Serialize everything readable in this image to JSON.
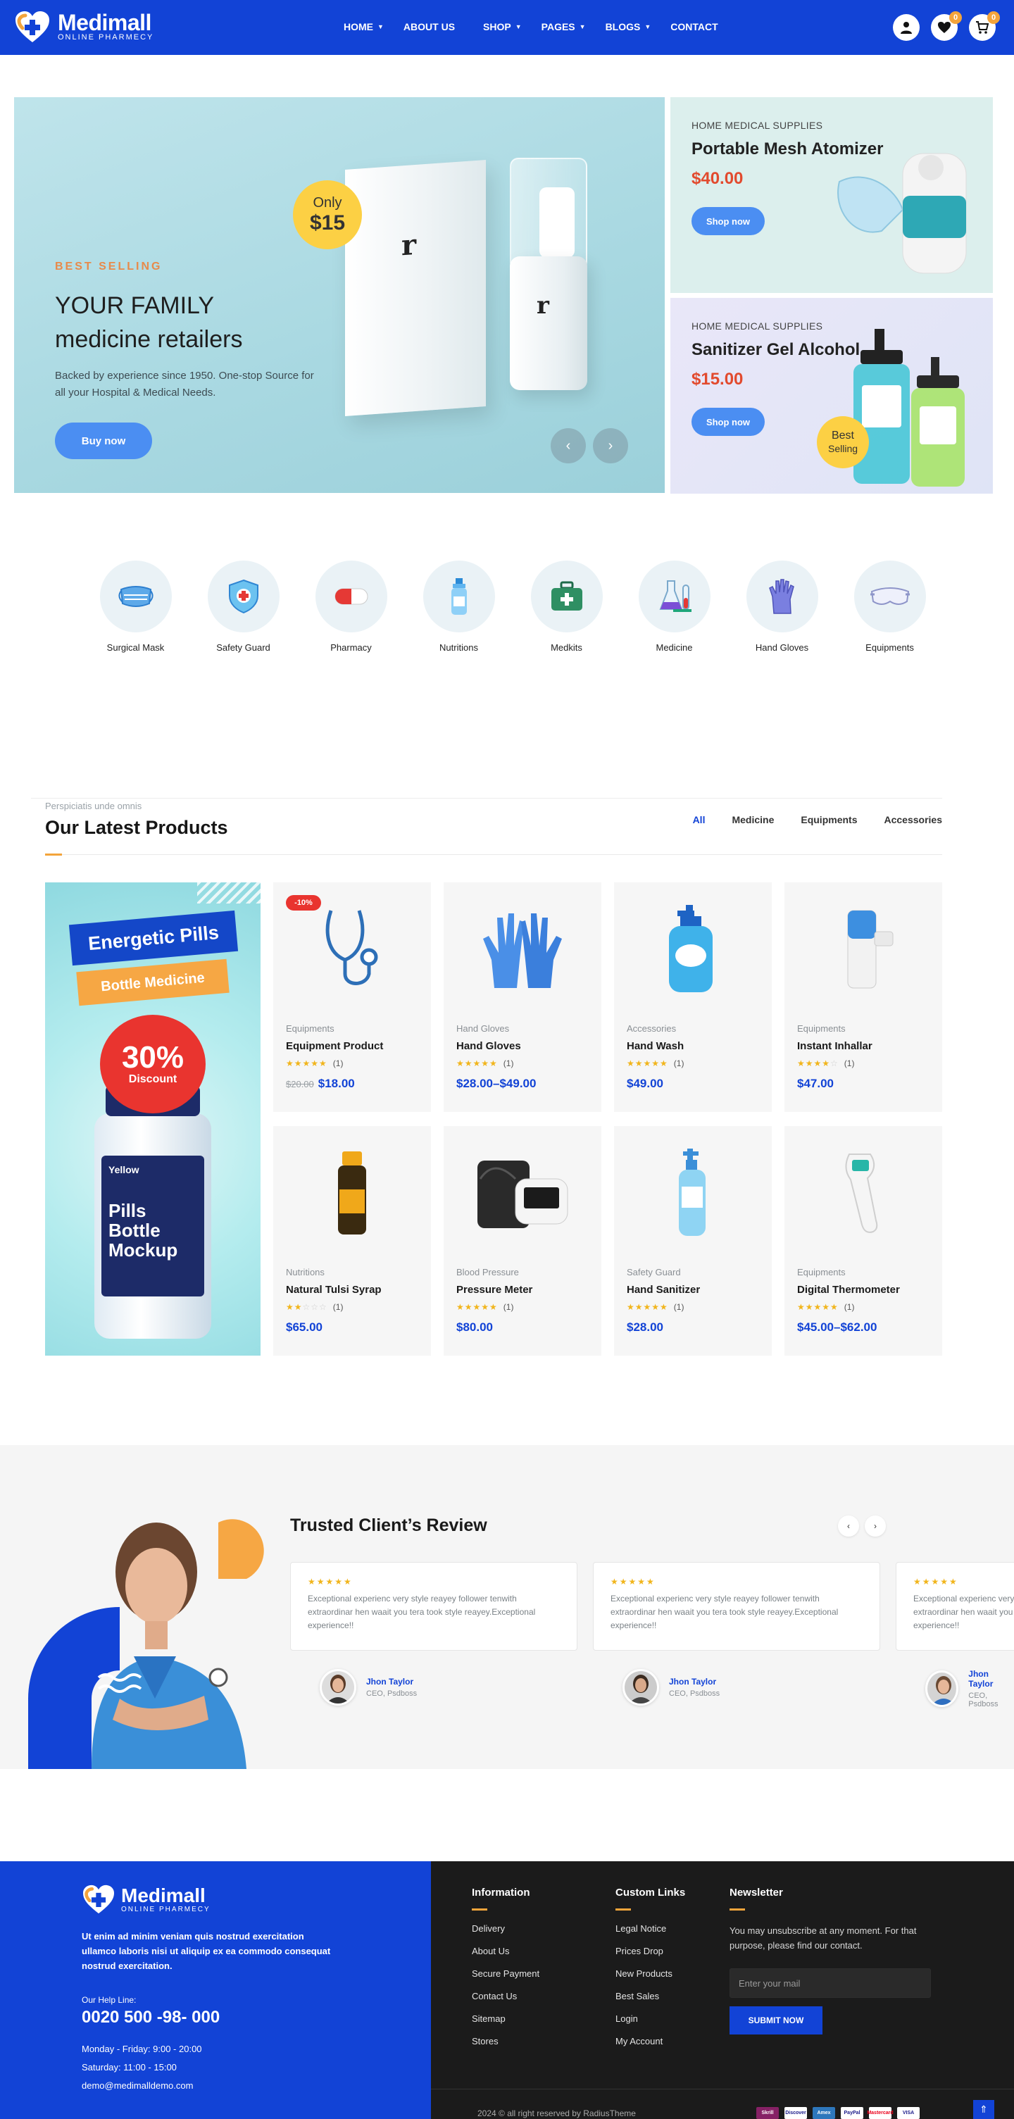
{
  "header": {
    "brand": "Medimall",
    "tagline": "ONLINE PHARMECY",
    "nav": [
      {
        "label": "HOME",
        "dropdown": true
      },
      {
        "label": "ABOUT US",
        "dropdown": false
      },
      {
        "label": "SHOP",
        "dropdown": true
      },
      {
        "label": "PAGES",
        "dropdown": true
      },
      {
        "label": "BLOGS",
        "dropdown": true
      },
      {
        "label": "CONTACT",
        "dropdown": false
      }
    ],
    "wishlist_count": "0",
    "cart_count": "0"
  },
  "hero": {
    "tag": "BEST SELLING",
    "title_line1": "YOUR FAMILY",
    "title_line2": "medicine retailers",
    "description": "Backed by experience since 1950. One-stop Source for all your Hospital & Medical Needs.",
    "button": "Buy now",
    "price_only": "Only",
    "price_amount": "$15",
    "box_brand": "r"
  },
  "promos": [
    {
      "category": "HOME MEDICAL SUPPLIES",
      "name": "Portable Mesh Atomizer",
      "price": "$40.00",
      "button": "Shop now"
    },
    {
      "category": "HOME MEDICAL SUPPLIES",
      "name": "Sanitizer Gel Alcohol",
      "price": "$15.00",
      "button": "Shop now",
      "badge_line1": "Best",
      "badge_line2": "Selling"
    }
  ],
  "categories": [
    {
      "label": "Surgical Mask",
      "icon": "surgical-mask-icon"
    },
    {
      "label": "Safety Guard",
      "icon": "safety-guard-icon"
    },
    {
      "label": "Pharmacy",
      "icon": "pharmacy-icon"
    },
    {
      "label": "Nutritions",
      "icon": "nutritions-icon"
    },
    {
      "label": "Medkits",
      "icon": "medkits-icon"
    },
    {
      "label": "Medicine",
      "icon": "medicine-icon"
    },
    {
      "label": "Hand Gloves",
      "icon": "hand-gloves-icon"
    },
    {
      "label": "Equipments",
      "icon": "equipments-icon"
    }
  ],
  "latest": {
    "subtitle": "Perspiciatis unde omnis",
    "title": "Our Latest Products",
    "tabs": [
      "All",
      "Medicine",
      "Equipments",
      "Accessories"
    ],
    "banner": {
      "title": "Energetic Pills",
      "subtitle": "Bottle Medicine",
      "discount": "30%",
      "discount_label": "Discount",
      "bottle_brand": "Yellow",
      "bottle_line1": "Pills",
      "bottle_line2": "Bottle",
      "bottle_line3": "Mockup"
    },
    "products": [
      {
        "category": "Equipments",
        "name": "Equipment Product",
        "rating": 5,
        "reviews": "(1)",
        "old_price": "$20.00",
        "price": "$18.00",
        "badge": "-10%"
      },
      {
        "category": "Hand Gloves",
        "name": "Hand Gloves",
        "rating": 5,
        "reviews": "(1)",
        "old_price": "",
        "price": "$28.00–$49.00",
        "badge": ""
      },
      {
        "category": "Accessories",
        "name": "Hand Wash",
        "rating": 5,
        "reviews": "(1)",
        "old_price": "",
        "price": "$49.00",
        "badge": ""
      },
      {
        "category": "Equipments",
        "name": "Instant Inhallar",
        "rating": 4,
        "reviews": "(1)",
        "old_price": "",
        "price": "$47.00",
        "badge": ""
      },
      {
        "category": "Nutritions",
        "name": "Natural Tulsi Syrap",
        "rating": 2,
        "reviews": "(1)",
        "old_price": "",
        "price": "$65.00",
        "badge": ""
      },
      {
        "category": "Blood Pressure",
        "name": "Pressure Meter",
        "rating": 5,
        "reviews": "(1)",
        "old_price": "",
        "price": "$80.00",
        "badge": ""
      },
      {
        "category": "Safety Guard",
        "name": "Hand Sanitizer",
        "rating": 5,
        "reviews": "(1)",
        "old_price": "",
        "price": "$28.00",
        "badge": ""
      },
      {
        "category": "Equipments",
        "name": "Digital Thermometer",
        "rating": 5,
        "reviews": "(1)",
        "old_price": "",
        "price": "$45.00–$62.00",
        "badge": ""
      }
    ]
  },
  "reviews": {
    "title": "Trusted Client’s Review",
    "items": [
      {
        "text": "Exceptional experienc very style reayey follower tenwith extraordinar hen waait you tera took style reayey.Exceptional experience!!",
        "name": "Jhon Taylor",
        "role": "CEO, Psdboss"
      },
      {
        "text": "Exceptional experienc very style reayey follower tenwith extraordinar hen waait you tera took style reayey.Exceptional experience!!",
        "name": "Jhon Taylor",
        "role": "CEO, Psdboss"
      },
      {
        "text": "Exceptional experienc very style reayey follower tenwith extraordinar hen waait you tera took style reayey.Exceptional experience!!",
        "name": "Jhon Taylor",
        "role": "CEO, Psdboss"
      }
    ]
  },
  "footer": {
    "brand": "Medimall",
    "tagline": "ONLINE PHARMECY",
    "about": "Ut enim ad minim veniam quis nostrud exercitation ullamco laboris nisi ut aliquip ex ea commodo consequat nostrud exercitation.",
    "help_label": "Our Help Line:",
    "phone": "0020 500 -98- 000",
    "hours1": "Monday - Friday: 9:00 - 20:00",
    "hours2": "Saturday: 11:00 - 15:00",
    "email": "demo@medimalldemo.com",
    "information_title": "Information",
    "information": [
      "Delivery",
      "About Us",
      "Secure Payment",
      "Contact Us",
      "Sitemap",
      "Stores"
    ],
    "custom_title": "Custom Links",
    "custom": [
      "Legal Notice",
      "Prices Drop",
      "New Products",
      "Best Sales",
      "Login",
      "My Account"
    ],
    "newsletter_title": "Newsletter",
    "newsletter_text": "You may unsubscribe at any moment. For that purpose, please find our contact.",
    "newsletter_placeholder": "Enter your mail",
    "submit": "SUBMIT NOW",
    "copyright": "2024 © all right reserved by RadiusTheme",
    "payments": [
      "Skrill",
      "Discover",
      "Amex",
      "PayPal",
      "Mastercard",
      "VISA"
    ]
  },
  "colors": {
    "primary": "#1243d6",
    "accent": "#f3a43b",
    "price_red": "#e24a2e",
    "button_blue": "#4b8ef2"
  }
}
